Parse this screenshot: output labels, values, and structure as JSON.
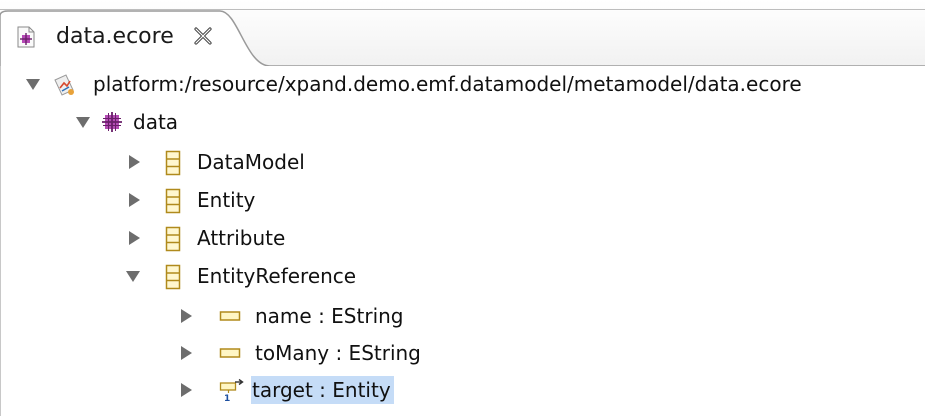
{
  "tab": {
    "title": "data.ecore",
    "icon": "ecore-file-icon",
    "close_icon": "close-icon"
  },
  "tree": {
    "root": {
      "label": "platform:/resource/xpand.demo.emf.datamodel/metamodel/data.ecore",
      "icon": "resource-icon",
      "expanded": true
    },
    "package": {
      "label": "data",
      "icon": "epackage-icon",
      "expanded": true
    },
    "classes": [
      {
        "label": "DataModel",
        "icon": "eclass-icon",
        "expanded": false
      },
      {
        "label": "Entity",
        "icon": "eclass-icon",
        "expanded": false
      },
      {
        "label": "Attribute",
        "icon": "eclass-icon",
        "expanded": false
      },
      {
        "label": "EntityReference",
        "icon": "eclass-icon",
        "expanded": true
      }
    ],
    "features": [
      {
        "label": "name : EString",
        "icon": "eattribute-icon",
        "selected": false
      },
      {
        "label": "toMany : EString",
        "icon": "eattribute-icon",
        "selected": false
      },
      {
        "label": "target : Entity",
        "icon": "ereference-icon",
        "selected": true
      }
    ]
  },
  "colors": {
    "selection": "#c5dcf7",
    "package": "#8a2a8a",
    "class_icon": "#c9a227"
  }
}
